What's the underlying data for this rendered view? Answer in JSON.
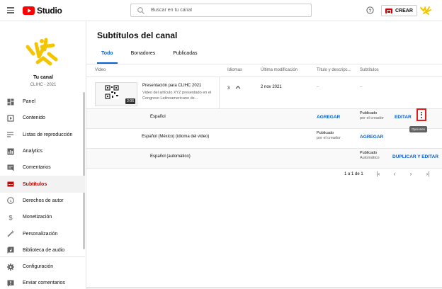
{
  "header": {
    "logo_text": "Studio",
    "search_placeholder": "Buscar en tu canal",
    "create_label": "CREAR"
  },
  "sidebar": {
    "channel_name": "Tu canal",
    "channel_subtitle": "CLIHC - 2021",
    "items": [
      {
        "label": "Panel",
        "icon": "dashboard-icon"
      },
      {
        "label": "Contenido",
        "icon": "content-icon"
      },
      {
        "label": "Listas de reproducción",
        "icon": "playlist-icon"
      },
      {
        "label": "Analytics",
        "icon": "analytics-icon"
      },
      {
        "label": "Comentarios",
        "icon": "comments-icon"
      },
      {
        "label": "Subtítulos",
        "icon": "subtitles-icon",
        "active": true
      },
      {
        "label": "Derechos de autor",
        "icon": "copyright-icon"
      },
      {
        "label": "Monetización",
        "icon": "dollar-icon"
      },
      {
        "label": "Personalización",
        "icon": "magic-wand-icon"
      },
      {
        "label": "Biblioteca de audio",
        "icon": "audio-library-icon"
      }
    ],
    "bottom_items": [
      {
        "label": "Configuración",
        "icon": "gear-icon"
      },
      {
        "label": "Enviar comentarios",
        "icon": "feedback-icon"
      }
    ]
  },
  "main": {
    "title": "Subtítulos del canal",
    "tabs": [
      {
        "label": "Todo",
        "active": true
      },
      {
        "label": "Borradores"
      },
      {
        "label": "Publicadas"
      }
    ],
    "columns": {
      "video": "Video",
      "languages": "Idiomas",
      "modified": "Última modificación",
      "title_desc": "Título y descripc...",
      "subtitles": "Subtítulos"
    },
    "video": {
      "title": "Presentación para CLIHC 2021",
      "description": "Video del artículo XYZ presentado en el Congreso Latinoamericano de...",
      "duration": "2:06",
      "languages_count": "3",
      "modified": "2 nov 2021",
      "title_desc_value": "–",
      "subtitles_value": "–"
    },
    "rows": [
      {
        "language": "Español",
        "title_action": "AGREGAR",
        "status": "Publicado",
        "status_sub": "por el creador",
        "action": "EDITAR"
      },
      {
        "language": "Español (México) (idioma del video)",
        "status": "Publicado",
        "status_sub": "por el creador",
        "subtitle_action": "AGREGAR"
      },
      {
        "language": "Español (automático)",
        "status": "Publicado",
        "status_sub": "Automático",
        "action": "DUPLICAR Y EDITAR"
      }
    ],
    "options_tooltip": "Opciones",
    "pagination": {
      "text": "1 a 1 de 1"
    }
  },
  "colors": {
    "accent": "#065fd4",
    "brand": "#ff0000",
    "active": "#cc0000"
  }
}
